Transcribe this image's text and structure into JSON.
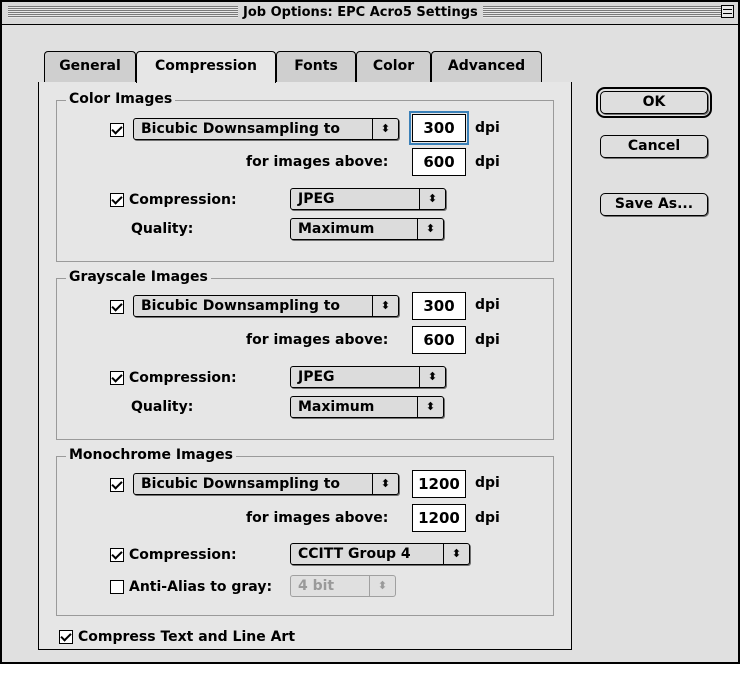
{
  "window": {
    "title": "Job Options: EPC Acro5 Settings"
  },
  "tabs": [
    {
      "label": "General",
      "active": false
    },
    {
      "label": "Compression",
      "active": true
    },
    {
      "label": "Fonts",
      "active": false
    },
    {
      "label": "Color",
      "active": false
    },
    {
      "label": "Advanced",
      "active": false
    }
  ],
  "buttons": {
    "ok": "OK",
    "cancel": "Cancel",
    "save_as": "Save As..."
  },
  "color_images": {
    "title": "Color Images",
    "downsample_checked": true,
    "downsample_method": "Bicubic Downsampling to",
    "resolution": "300",
    "resolution_unit": "dpi",
    "above_label": "for images above:",
    "above_value": "600",
    "above_unit": "dpi",
    "compression_checked": true,
    "compression_label": "Compression:",
    "compression_value": "JPEG",
    "quality_label": "Quality:",
    "quality_value": "Maximum"
  },
  "grayscale_images": {
    "title": "Grayscale Images",
    "downsample_checked": true,
    "downsample_method": "Bicubic Downsampling to",
    "resolution": "300",
    "resolution_unit": "dpi",
    "above_label": "for images above:",
    "above_value": "600",
    "above_unit": "dpi",
    "compression_checked": true,
    "compression_label": "Compression:",
    "compression_value": "JPEG",
    "quality_label": "Quality:",
    "quality_value": "Maximum"
  },
  "monochrome_images": {
    "title": "Monochrome Images",
    "downsample_checked": true,
    "downsample_method": "Bicubic Downsampling to",
    "resolution": "1200",
    "resolution_unit": "dpi",
    "above_label": "for images above:",
    "above_value": "1200",
    "above_unit": "dpi",
    "compression_checked": true,
    "compression_label": "Compression:",
    "compression_value": "CCITT Group 4",
    "antialias_checked": false,
    "antialias_label": "Anti-Alias to gray:",
    "antialias_value": "4 bit"
  },
  "compress_text": {
    "label": "Compress Text and Line Art",
    "checked": true
  },
  "icons": {
    "popup_arrow": "⬍"
  }
}
